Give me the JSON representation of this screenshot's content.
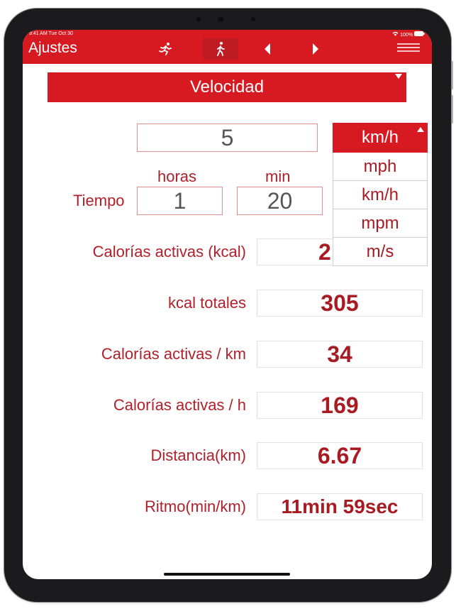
{
  "status": {
    "time": "9:41 AM  Tue Oct 30",
    "battery": "100%"
  },
  "nav": {
    "title": "Ajustes",
    "icons": [
      "running-icon",
      "walking-icon",
      "previous-icon",
      "next-icon",
      "menu-icon"
    ]
  },
  "selector": {
    "value": "Velocidad"
  },
  "speed": {
    "value": "5"
  },
  "unit_dropdown": {
    "selected": "km/h",
    "options": [
      "mph",
      "km/h",
      "mpm",
      "m/s"
    ]
  },
  "time": {
    "label": "Tiempo",
    "hours_label": "horas",
    "min_label": "min",
    "hours": "1",
    "minutes": "20"
  },
  "results": [
    {
      "label": "Calorías activas (kcal)",
      "value": "2"
    },
    {
      "label": "kcal totales",
      "value": "305"
    },
    {
      "label": "Calorías activas / km",
      "value": "34"
    },
    {
      "label": "Calorías activas / h",
      "value": "169"
    },
    {
      "label": "Distancia(km)",
      "value": "6.67"
    },
    {
      "label": "Ritmo(min/km)",
      "value": "11min 59sec"
    }
  ],
  "colors": {
    "accent": "#d71a21",
    "text_red": "#b0202a",
    "value_red": "#a81b23"
  }
}
